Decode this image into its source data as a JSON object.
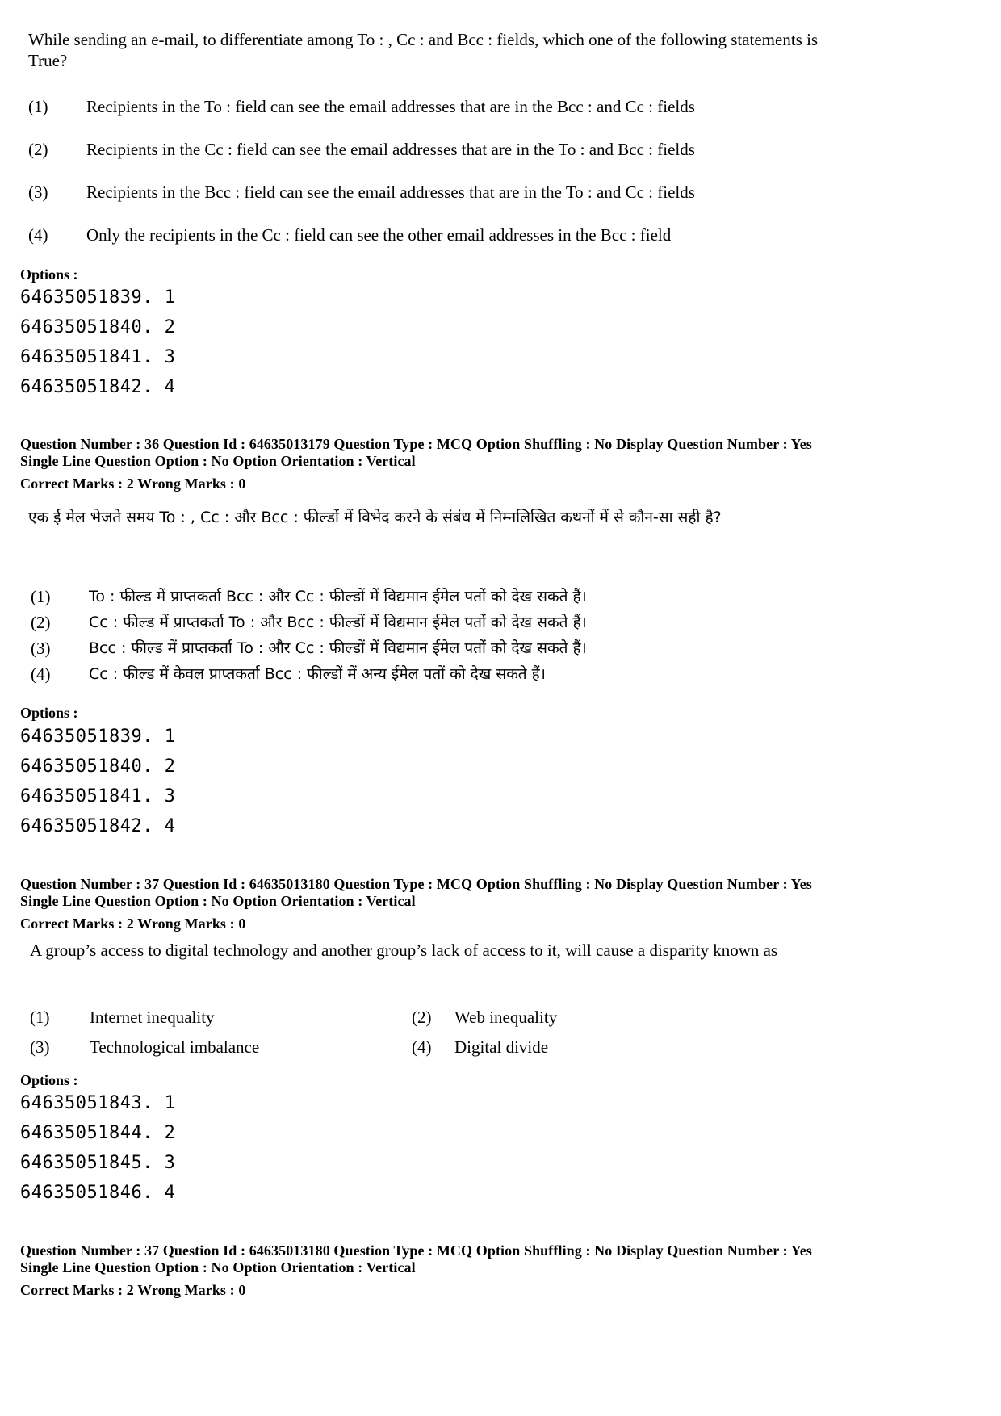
{
  "blocks": [
    {
      "question_text": "While sending an e-mail, to differentiate among To : , Cc : and Bcc : fields, which one of the following statements is True?",
      "choices": [
        {
          "num": "(1)",
          "text": "Recipients in the To : field can see the email addresses that are in the Bcc : and Cc : fields"
        },
        {
          "num": "(2)",
          "text": "Recipients in the Cc : field can see the email addresses that are in the To : and Bcc : fields"
        },
        {
          "num": "(3)",
          "text": "Recipients in the Bcc : field can see the email addresses that are in the To : and Cc : fields"
        },
        {
          "num": "(4)",
          "text": "Only the recipients in the Cc : field can see the other email addresses in the Bcc : field"
        }
      ],
      "options_label": "Options :",
      "options": [
        "64635051839. 1",
        "64635051840. 2",
        "64635051841. 3",
        "64635051842. 4"
      ]
    },
    {
      "meta_line1": "Question Number : 36  Question Id : 64635013179  Question Type : MCQ  Option Shuffling : No  Display Question Number : Yes",
      "meta_line2": "Single Line Question Option : No  Option Orientation : Vertical",
      "marks": "Correct Marks : 2  Wrong Marks : 0",
      "question_text": "एक ई मेल भेजते समय To : , Cc : और Bcc : फील्डों में विभेद करने के संबंध में निम्नलिखित कथनों में से कौन-सा सही है?",
      "choices": [
        {
          "num": "(1)",
          "text": "To : फील्ड में प्राप्तकर्ता Bcc : और Cc : फील्डों में विद्यमान ईमेल पतों को देख सकते हैं।"
        },
        {
          "num": "(2)",
          "text": "Cc : फील्ड में प्राप्तकर्ता To : और Bcc : फील्डों में विद्यमान ईमेल पतों को देख सकते हैं।"
        },
        {
          "num": "(3)",
          "text": "Bcc : फील्ड में प्राप्तकर्ता To : और Cc : फील्डों में विद्यमान ईमेल पतों को देख सकते हैं।"
        },
        {
          "num": "(4)",
          "text": "Cc : फील्ड में केवल प्राप्तकर्ता Bcc : फील्डों में अन्य ईमेल पतों को देख सकते हैं।"
        }
      ],
      "options_label": "Options :",
      "options": [
        "64635051839. 1",
        "64635051840. 2",
        "64635051841. 3",
        "64635051842. 4"
      ]
    },
    {
      "meta_line1": "Question Number : 37  Question Id : 64635013180  Question Type : MCQ  Option Shuffling : No  Display Question Number : Yes",
      "meta_line2": "Single Line Question Option : No  Option Orientation : Vertical",
      "marks": "Correct Marks : 2  Wrong Marks : 0",
      "question_text": "A group’s access to digital technology and another group’s lack of access to it, will cause a disparity known as",
      "choices": [
        {
          "num": "(1)",
          "text": "Internet inequality"
        },
        {
          "num": "(2)",
          "text": "Web inequality"
        },
        {
          "num": "(3)",
          "text": "Technological imbalance"
        },
        {
          "num": "(4)",
          "text": "Digital divide"
        }
      ],
      "options_label": "Options :",
      "options": [
        "64635051843. 1",
        "64635051844. 2",
        "64635051845. 3",
        "64635051846. 4"
      ]
    },
    {
      "meta_line1": "Question Number : 37  Question Id : 64635013180  Question Type : MCQ  Option Shuffling : No  Display Question Number : Yes",
      "meta_line2": "Single Line Question Option : No  Option Orientation : Vertical",
      "marks": "Correct Marks : 2  Wrong Marks : 0"
    }
  ]
}
